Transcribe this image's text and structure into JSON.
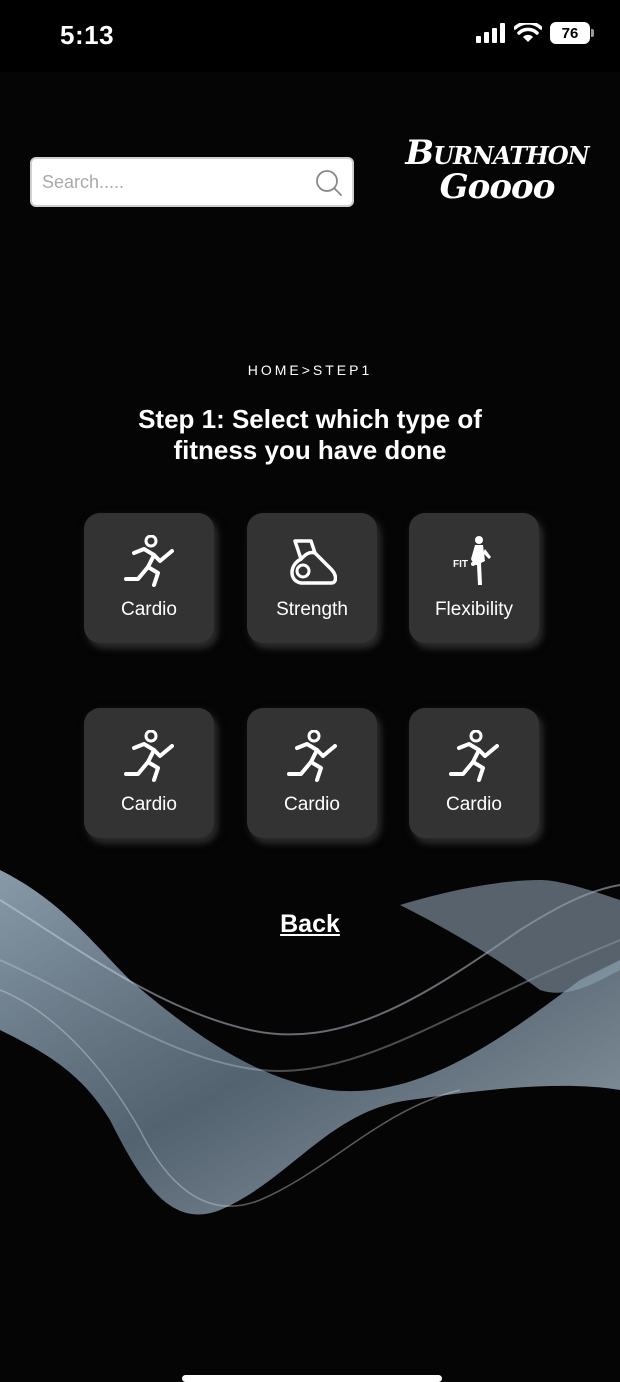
{
  "status": {
    "time": "5:13",
    "battery": "76",
    "icons": [
      "signal-icon",
      "wifi-icon",
      "battery-icon"
    ]
  },
  "search": {
    "placeholder": "Search.....",
    "value": "",
    "icon": "search-icon"
  },
  "brand": {
    "line1": "Burnathon",
    "line2": "Goooo"
  },
  "breadcrumb": "HOME>STEP1",
  "heading": {
    "line1": "Step 1: Select which type of",
    "line2": "fitness you have done"
  },
  "tiles": [
    {
      "label": "Cardio",
      "icon": "running-icon"
    },
    {
      "label": "Strength",
      "icon": "kettlebell-icon"
    },
    {
      "label": "Flexibility",
      "icon": "fitness-figure-icon"
    },
    {
      "label": "Cardio",
      "icon": "running-icon"
    },
    {
      "label": "Cardio",
      "icon": "running-icon"
    },
    {
      "label": "Cardio",
      "icon": "running-icon"
    }
  ],
  "back_label": "Back",
  "colors": {
    "background": "#000000",
    "tile": "#333333",
    "text": "#ffffff",
    "wave": "#8fa3b5"
  }
}
